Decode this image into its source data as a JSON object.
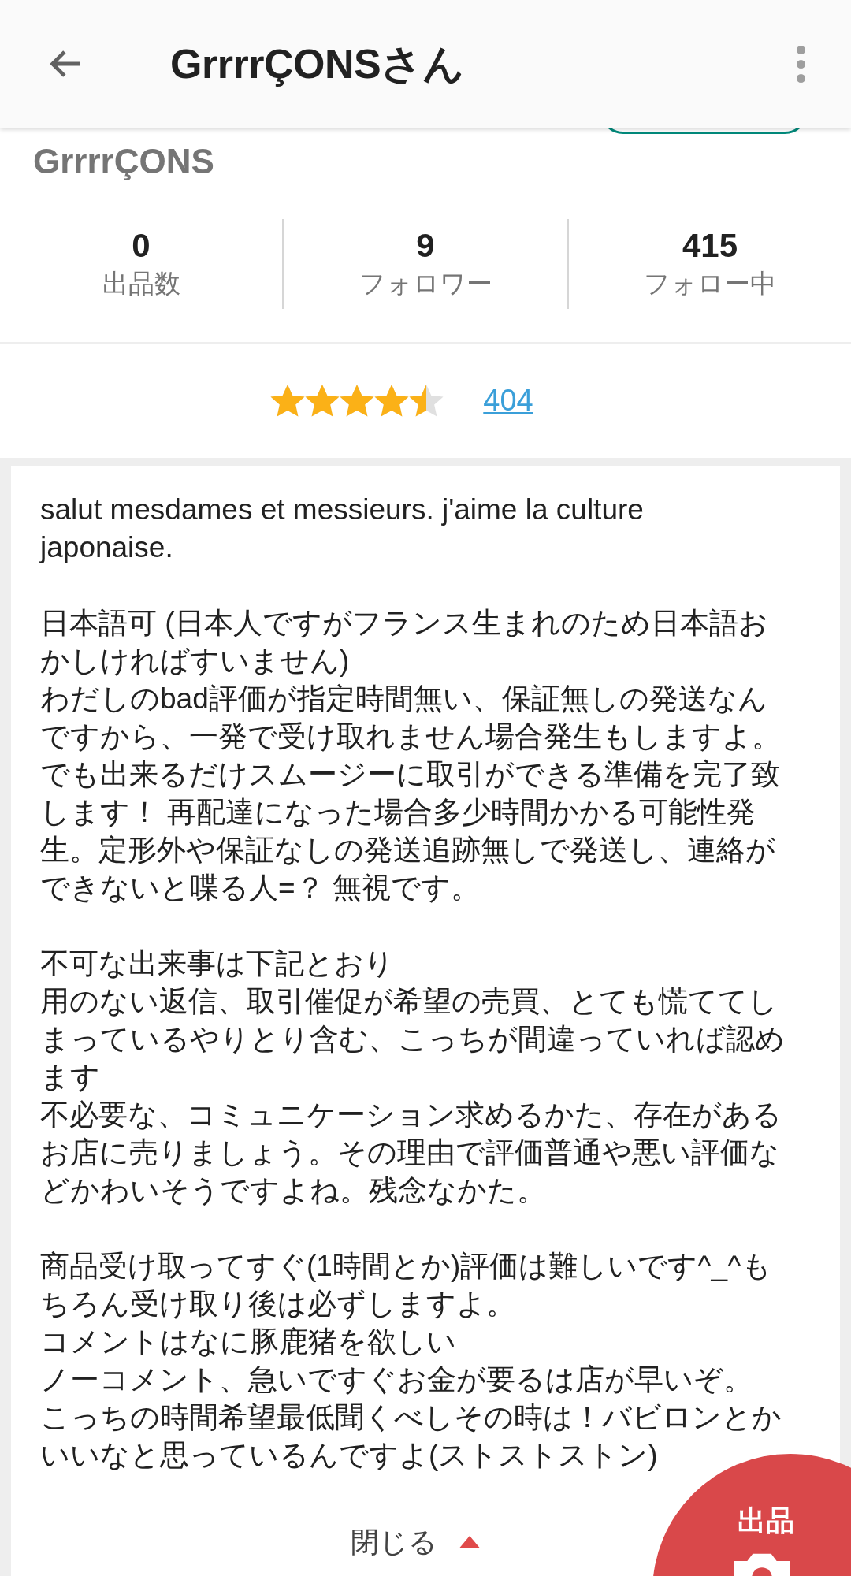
{
  "app_bar": {
    "title": "GrrrrÇONSさん"
  },
  "profile": {
    "name": "GrrrrÇONS"
  },
  "stats": [
    {
      "value": "0",
      "label": "出品数"
    },
    {
      "value": "9",
      "label": "フォロワー"
    },
    {
      "value": "415",
      "label": "フォロー中"
    }
  ],
  "rating": {
    "stars": 4.5,
    "count": "404"
  },
  "description": [
    [
      "salut mesdames et messieurs. j'aime la culture",
      "japonaise."
    ],
    [
      "日本語可 (日本人ですがフランス生まれのため日本語お",
      "かしければすいません)",
      "わだしのbad評価が指定時間無い、保証無しの発送なん",
      "ですから、一発で受け取れません場合発生もしますよ。",
      "でも出来るだけスムージーに取引ができる準備を完了致",
      "します！ 再配達になった場合多少時間かかる可能性発",
      "生。定形外や保証なしの発送追跡無しで発送し、連絡が",
      "できないと喋る人=？ 無視です。"
    ],
    [
      "不可な出来事は下記とおり",
      "用のない返信、取引催促が希望の売買、とても慌ててし",
      "まっているやりとり含む、こっちが間違っていれば認め",
      "ます",
      "不必要な、コミュニケーション求めるかた、存在がある",
      "お店に売りましょう。その理由で評価普通や悪い評価な",
      "どかわいそうですよね。残念なかた。"
    ],
    [
      "商品受け取ってすぐ(1時間とか)評価は難しいです^_^も",
      "ちろん受け取り後は必ずしますよ。",
      "コメントはなに豚鹿猪を欲しい",
      "ノーコメント、急いですぐお金が要るは店が早いぞ。",
      "こっちの時間希望最低聞くべしその時は！バビロンとか",
      "いいなと思っているんですよ(ストストストン)"
    ]
  ],
  "close_button": {
    "label": "閉じる"
  },
  "fab": {
    "label": "出品"
  }
}
